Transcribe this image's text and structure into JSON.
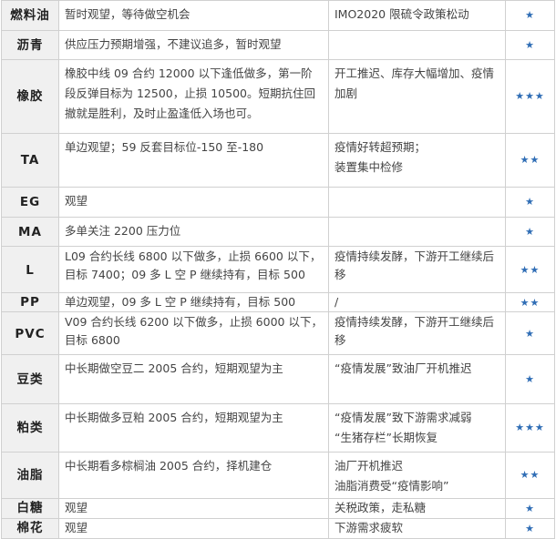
{
  "rows": [
    {
      "name": "燃料油",
      "view": "暂时观望，等待做空机会",
      "factor": "IMO2020 限硫令政策松动",
      "rating": "★"
    },
    {
      "name": "沥青",
      "view": "供应压力预期增强，不建议追多，暂时观望",
      "factor": "",
      "rating": "★"
    },
    {
      "name": "橡胶",
      "view": "橡胶中线 09 合约 12000 以下逢低做多，第一阶段反弹目标为 12500，止损 10500。短期抗住回撤就是胜利，及时止盈逢低入场也可。",
      "factor": "开工推迟、库存大幅增加、疫情加剧",
      "rating": "★★★"
    },
    {
      "name": "TA",
      "view": "单边观望；59 反套目标位-150 至-180",
      "factor": "疫情好转超预期；\n装置集中检修",
      "rating": "★★"
    },
    {
      "name": "EG",
      "view": "观望",
      "factor": "",
      "rating": "★"
    },
    {
      "name": "MA",
      "view": "多单关注 2200 压力位",
      "factor": "",
      "rating": "★"
    },
    {
      "name": "L",
      "view": "L09 合约长线 6800 以下做多，止损 6600 以下，目标 7400；09 多 L 空 P 继续持有，目标 500",
      "factor": "疫情持续发酵，下游开工继续后移",
      "rating": "★★"
    },
    {
      "name": "PP",
      "view": "单边观望，09 多 L 空 P 继续持有，目标 500",
      "factor": "/",
      "rating": "★★"
    },
    {
      "name": "PVC",
      "view": "V09 合约长线 6200 以下做多，止损 6000 以下，目标 6800",
      "factor": "疫情持续发酵，下游开工继续后移",
      "rating": "★"
    },
    {
      "name": "豆类",
      "view": "中长期做空豆二 2005 合约，短期观望为主",
      "factor": "“疫情发展”致油厂开机推迟",
      "rating": "★"
    },
    {
      "name": "粕类",
      "view": "中长期做多豆粕 2005 合约，短期观望为主",
      "factor": "“疫情发展”致下游需求减弱\n“生猪存栏”长期恢复",
      "rating": "★★★"
    },
    {
      "name": "油脂",
      "view": "中长期看多棕榈油 2005 合约，择机建仓",
      "factor": "油厂开机推迟\n油脂消费受“疫情影响”",
      "rating": "★★"
    },
    {
      "name": "白糖",
      "view": "观望",
      "factor": "关税政策，走私糖",
      "rating": "★"
    },
    {
      "name": "棉花",
      "view": "观望",
      "factor": "下游需求疲软",
      "rating": "★"
    }
  ],
  "colors": {
    "star": "#2f6db5",
    "name_bg": "#f0f0f0",
    "border": "#d0d0d0"
  },
  "icons": {
    "rating": "star-icon"
  }
}
